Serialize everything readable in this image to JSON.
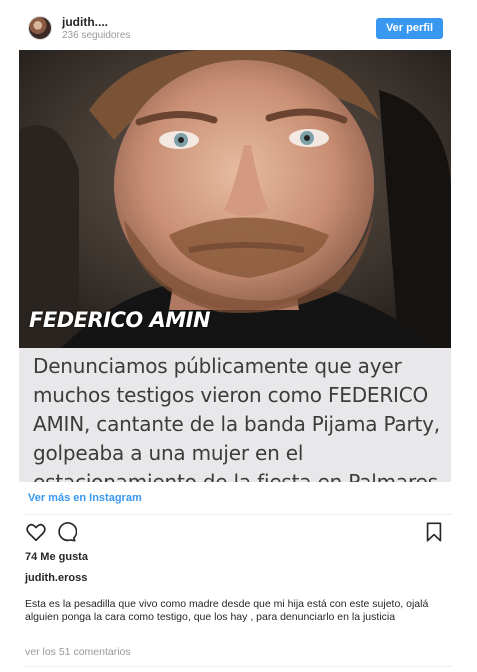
{
  "header": {
    "username": "judith....",
    "followers": "236 seguidores",
    "profile_button": "Ver perfil"
  },
  "photo": {
    "name_tag": "FEDERICO AMIN",
    "caption_lines": [
      "Denunciamos públicamente que ayer",
      "muchos testigos vieron como FEDERICO",
      "AMIN, cantante de la banda Pijama Party,",
      "golpeaba a una mujer en el",
      "estacionamiento de la fiesta en Palmares"
    ]
  },
  "links": {
    "view_more": "Ver más en Instagram"
  },
  "icons": {
    "like": "heart-icon",
    "comment": "comment-icon",
    "save": "bookmark-icon"
  },
  "post": {
    "likes": "74 Me gusta",
    "author": "judith.eross",
    "caption": "Esta es la pesadilla que vivo como madre desde que mi hija está con este sujeto, ojalá alguien ponga la cara como testigo, que los hay , para denunciarlo en la justicia",
    "comments_link": "ver los 51 comentarios"
  },
  "colors": {
    "accent": "#3897f0",
    "muted": "#999999",
    "text": "#262626"
  }
}
